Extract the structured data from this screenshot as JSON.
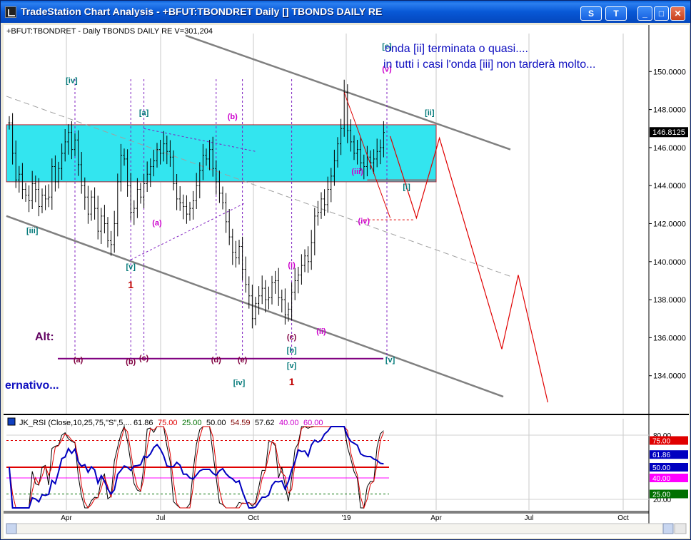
{
  "window": {
    "title": "TradeStation Chart Analysis  - +BFUT:TBONDRET Daily []  TBONDS DAILY RE",
    "btn_s": "S",
    "btn_tools": "T",
    "btn_min": "_",
    "btn_max": "□",
    "btn_close": "✕"
  },
  "colors": {
    "zone": "#33e5ef",
    "bars": "#000000",
    "channel": "#808080",
    "wave_label_teal": "#007878",
    "wave_label_magenta": "#cc00cc",
    "wave_label_maroon": "#800040",
    "projection": "#e00000",
    "annotation_blue": "#1010c0",
    "dotted_violet": "#8020c0"
  },
  "chart_data": [
    {
      "type": "bar",
      "subtype": "ohlc",
      "header": "+BFUT:TBONDRET - Daily  TBONDS DAILY RE  V=301,204",
      "annotations": [
        "onda [ii] terminata o quasi....",
        "in tutti i casi l'onda [iii] non tarderà molto..."
      ],
      "side_text": "ernativo...",
      "alt_label": "Alt:",
      "last_price": "146.8125",
      "y_ticks": [
        "150.0000",
        "148.0000",
        "146.0000",
        "144.0000",
        "142.0000",
        "140.0000",
        "138.0000",
        "136.0000",
        "134.0000"
      ],
      "x_ticks": [
        "Apr",
        "Jul",
        "Oct",
        "'19",
        "Apr",
        "Jul",
        "Oct"
      ],
      "ylim": [
        132.0,
        152.0
      ],
      "zone": {
        "from": 144.2,
        "to": 147.2
      },
      "closes": [
        147.3,
        145.7,
        144.3,
        144.6,
        143.8,
        143.5,
        143.2,
        144.1,
        143.8,
        142.9,
        143.5,
        143.3,
        143.4,
        145.0,
        144.2,
        144.9,
        145.7,
        146.3,
        146.8,
        145.9,
        146.4,
        145.1,
        144.0,
        143.4,
        142.5,
        143.4,
        142.8,
        141.6,
        142.4,
        142.0,
        141.1,
        140.9,
        142.0,
        144.2,
        145.6,
        145.4,
        144.0,
        142.6,
        142.8,
        143.8,
        143.4,
        144.1,
        144.6,
        145.0,
        145.3,
        145.9,
        145.7,
        146.2,
        145.8,
        145.5,
        144.1,
        143.3,
        143.1,
        142.9,
        142.5,
        142.8,
        143.2,
        144.0,
        144.8,
        145.6,
        145.4,
        145.9,
        144.9,
        144.2,
        143.6,
        143.1,
        142.1,
        141.3,
        140.5,
        140.2,
        140.8,
        139.6,
        138.8,
        138.2,
        137.0,
        137.8,
        138.2,
        138.6,
        138.0,
        138.1,
        138.9,
        139.0,
        138.1,
        138.0,
        137.2,
        137.5,
        138.4,
        139.0,
        139.3,
        139.8,
        140.3,
        140.0,
        141.0,
        142.4,
        142.6,
        143.3,
        143.0,
        143.8,
        144.5,
        145.3,
        146.2,
        147.0,
        148.9,
        146.9,
        146.3,
        145.7,
        145.9,
        145.2,
        145.0,
        145.5,
        145.2,
        145.4,
        145.8,
        146.0,
        146.8
      ],
      "projection": [
        [
          116,
          146.6
        ],
        [
          124,
          142.3
        ],
        [
          131,
          146.5
        ],
        [
          150,
          135.4
        ],
        [
          155,
          139.3
        ],
        [
          164,
          132.6
        ]
      ],
      "wave_labels": [
        {
          "t": "[iv]",
          "x": 19,
          "y": 149.4
        },
        {
          "t": "[iii]",
          "x": 7,
          "y": 141.5
        },
        {
          "t": "[v]",
          "x": 37,
          "y": 139.6
        },
        {
          "t": "1",
          "x": 37,
          "y": 138.6
        },
        {
          "t": "[a]",
          "x": 41,
          "y": 147.7
        },
        {
          "t": "(a)",
          "x": 45,
          "y": 141.9
        },
        {
          "t": "(b)",
          "x": 68,
          "y": 147.5
        },
        {
          "t": "(i)",
          "x": 86,
          "y": 139.7
        },
        {
          "t": "(c)",
          "x": 86,
          "y": 135.9
        },
        {
          "t": "(ii)",
          "x": 95,
          "y": 136.2
        },
        {
          "t": "(iii)",
          "x": 106,
          "y": 144.6
        },
        {
          "t": "(iv)",
          "x": 108,
          "y": 142.0
        },
        {
          "t": "(v)",
          "x": 115,
          "y": 150.0
        },
        {
          "t": "[c]",
          "x": 115,
          "y": 151.2
        },
        {
          "t": "[ii]",
          "x": 128,
          "y": 147.7
        },
        {
          "t": "[i]",
          "x": 121,
          "y": 143.8
        },
        {
          "t": "[b]",
          "x": 86,
          "y": 135.2
        },
        {
          "t": "[v]",
          "x": 86,
          "y": 134.4
        },
        {
          "t": "1",
          "x": 86,
          "y": 133.5
        },
        {
          "t": "[iv]",
          "x": 70,
          "y": 133.5
        },
        {
          "t": "[v]",
          "x": 116,
          "y": 134.7
        },
        {
          "t": "(a)",
          "x": 21,
          "y": 134.7
        },
        {
          "t": "(b)",
          "x": 37,
          "y": 134.6
        },
        {
          "t": "(c)",
          "x": 41,
          "y": 134.8
        },
        {
          "t": "(d)",
          "x": 63,
          "y": 134.7
        },
        {
          "t": "(e)",
          "x": 71,
          "y": 134.7
        }
      ]
    },
    {
      "type": "line",
      "header": "JK_RSI (Close,10,25,75,\"S\",5,...",
      "readouts": [
        {
          "t": "61.86",
          "c": "#000000"
        },
        {
          "t": "75.00",
          "c": "#e00000"
        },
        {
          "t": "25.00",
          "c": "#007000"
        },
        {
          "t": "50.00",
          "c": "#000000"
        },
        {
          "t": "54.59",
          "c": "#800000"
        },
        {
          "t": "57.62",
          "c": "#000000"
        },
        {
          "t": "40.00",
          "c": "#cc00cc"
        },
        {
          "t": "60.00",
          "c": "#cc00cc"
        }
      ],
      "y_ticks": [
        "80.00",
        "20.00"
      ],
      "ylim": [
        10,
        90
      ],
      "tags": [
        {
          "t": "75.00",
          "v": 75,
          "bg": "#e00000",
          "fg": "#ffffff"
        },
        {
          "t": "61.86",
          "v": 61.86,
          "bg": "#0000c0",
          "fg": "#ffffff"
        },
        {
          "t": "50.00",
          "v": 50,
          "bg": "#0000c0",
          "fg": "#ffffff"
        },
        {
          "t": "40.00",
          "v": 40,
          "bg": "#ff00ff",
          "fg": "#ffffff"
        },
        {
          "t": "25.00",
          "v": 25,
          "bg": "#007000",
          "fg": "#ffffff"
        }
      ]
    }
  ]
}
